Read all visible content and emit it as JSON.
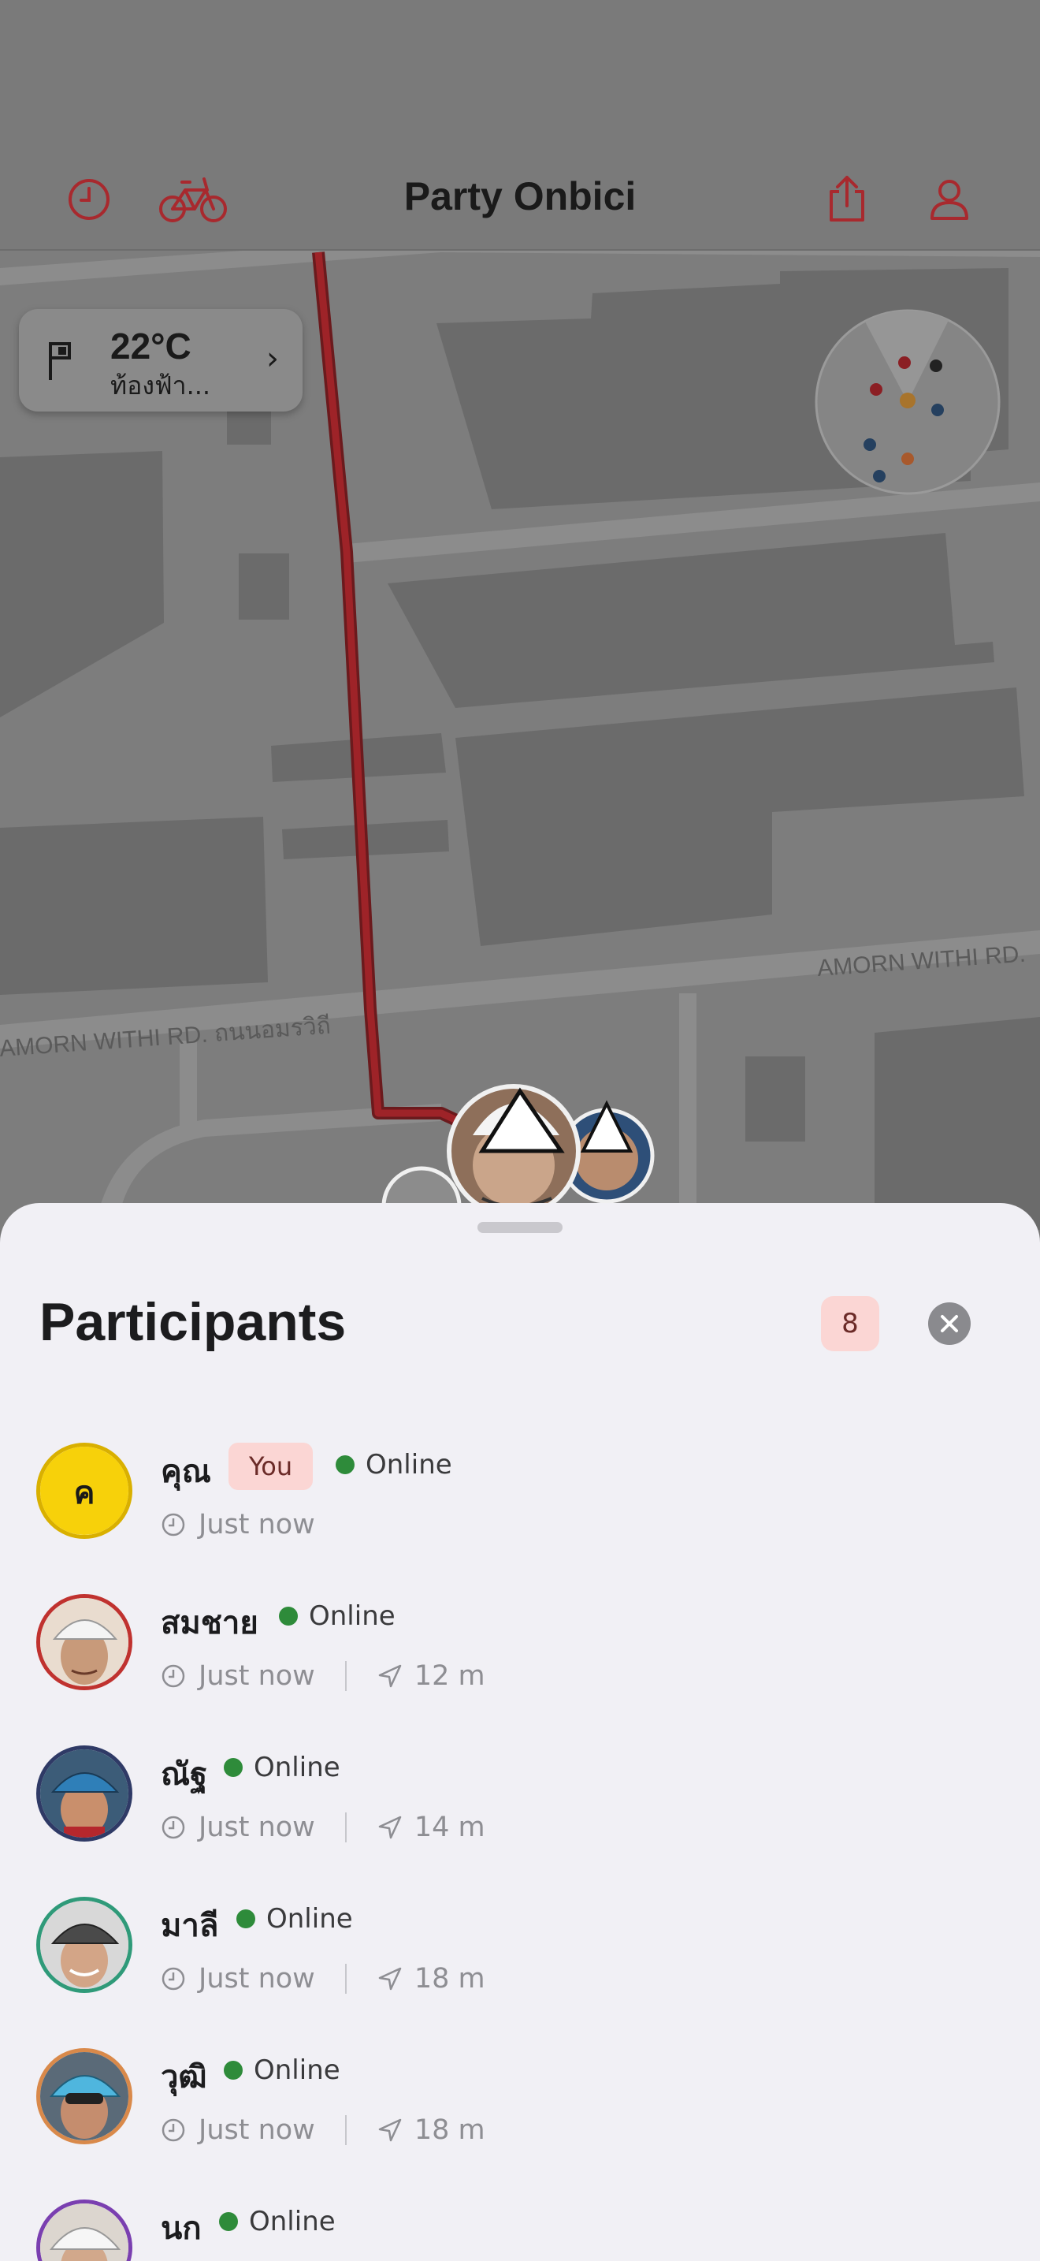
{
  "header": {
    "title": "Party Onbici",
    "history_icon": "clock-icon",
    "bike_icon": "bicycle-icon",
    "share_icon": "share-icon",
    "profile_icon": "person-icon"
  },
  "weather": {
    "temperature": "22°C",
    "condition": "ท้องฟ้า...",
    "icon": "flag-icon"
  },
  "map": {
    "street_labels": [
      "AMORN WITHI RD.",
      "AMORN WITHI RD. ถนนอมรวิถี"
    ],
    "route_color": "#b5272d"
  },
  "sheet": {
    "title": "Participants",
    "count": "8",
    "close_icon": "close-icon"
  },
  "participants": [
    {
      "name": "คุณ",
      "initial": "ค",
      "is_you": true,
      "you_label": "You",
      "status": "Online",
      "time": "Just now",
      "distance": "",
      "ring": "#e0b500"
    },
    {
      "name": "สมชาย",
      "is_you": false,
      "status": "Online",
      "time": "Just now",
      "distance": "12 m",
      "ring": "#c0322f"
    },
    {
      "name": "ณัฐ",
      "is_you": false,
      "status": "Online",
      "time": "Just now",
      "distance": "14 m",
      "ring": "#2f3a66"
    },
    {
      "name": "มาลี",
      "is_you": false,
      "status": "Online",
      "time": "Just now",
      "distance": "18 m",
      "ring": "#2f9a79"
    },
    {
      "name": "วุฒิ",
      "is_you": false,
      "status": "Online",
      "time": "Just now",
      "distance": "18 m",
      "ring": "#d9894a"
    },
    {
      "name": "นก",
      "is_you": false,
      "status": "Online",
      "time": "",
      "distance": "",
      "ring": "#7a3fb0"
    }
  ],
  "colors": {
    "accent": "#b5272d",
    "online": "#2e8b3a",
    "badge_bg": "#fbd6d4"
  }
}
